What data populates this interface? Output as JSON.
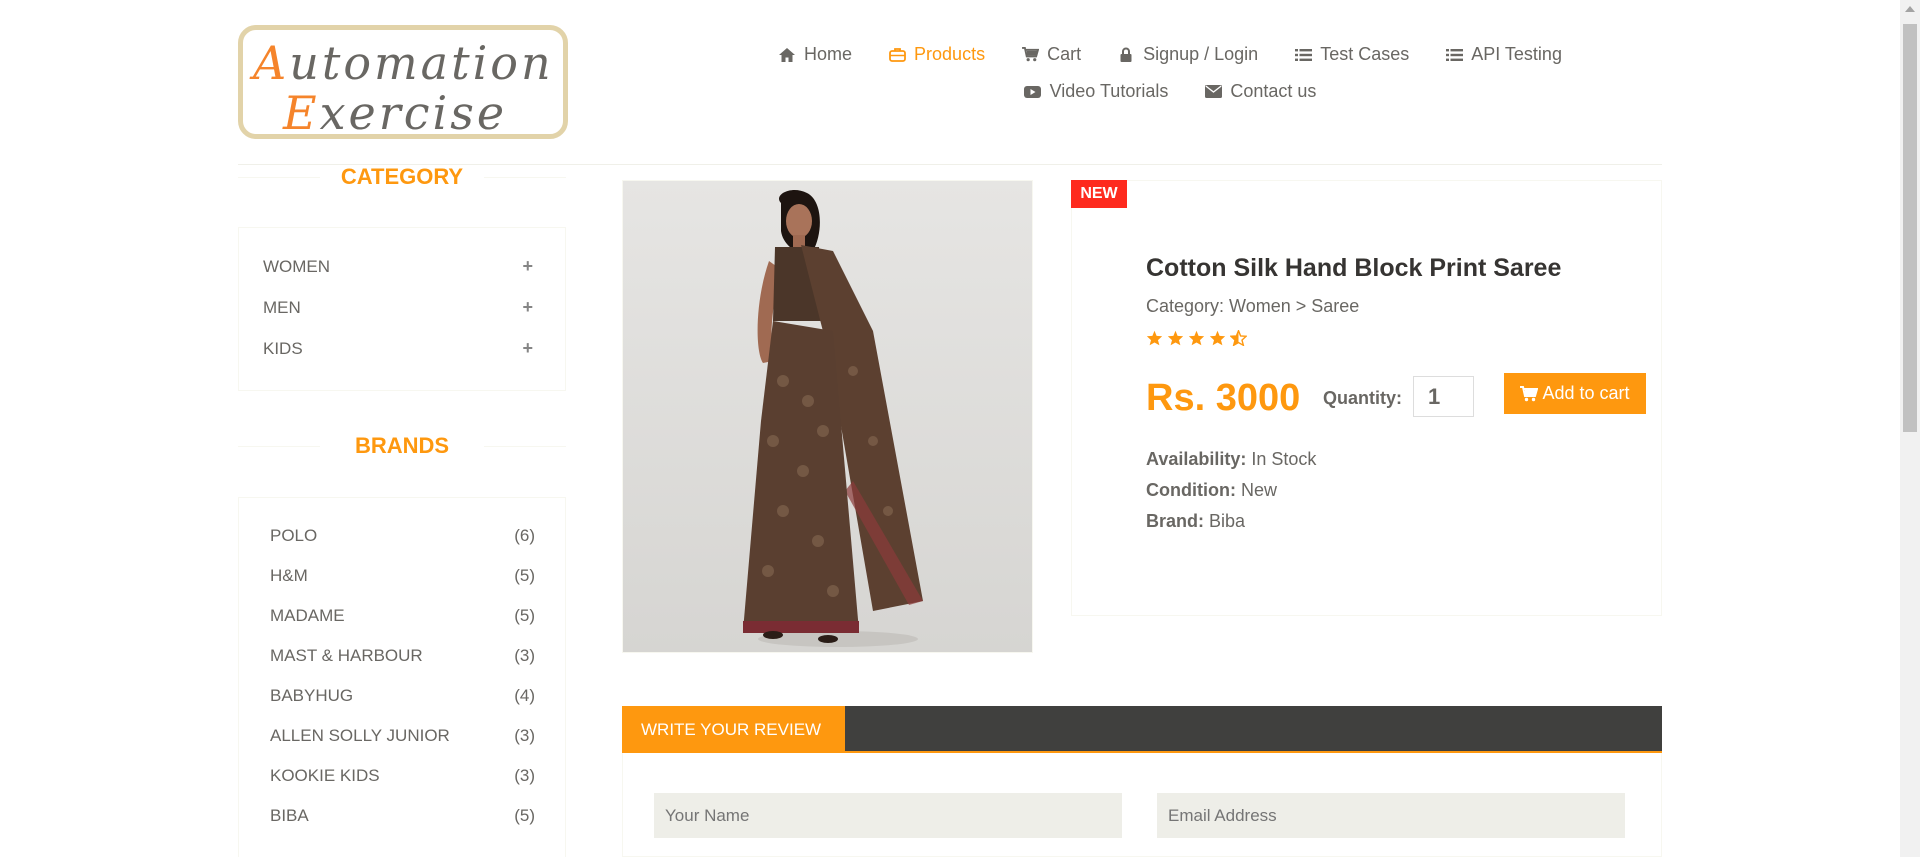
{
  "logo": {
    "line1_cap": "A",
    "line1_rest": "utomation",
    "line2_cap": "E",
    "line2_rest": "xercise"
  },
  "nav": {
    "row1": [
      {
        "label": "Home",
        "icon": "home-icon"
      },
      {
        "label": "Products",
        "icon": "briefcase-icon",
        "active": true
      },
      {
        "label": "Cart",
        "icon": "cart-icon"
      },
      {
        "label": "Signup / Login",
        "icon": "lock-icon"
      },
      {
        "label": "Test Cases",
        "icon": "list-icon"
      },
      {
        "label": "API Testing",
        "icon": "list-icon"
      }
    ],
    "row2": [
      {
        "label": "Video Tutorials",
        "icon": "youtube-icon"
      },
      {
        "label": "Contact us",
        "icon": "envelope-icon"
      }
    ]
  },
  "sidebar": {
    "category_title": "CATEGORY",
    "categories": [
      "WOMEN",
      "MEN",
      "KIDS"
    ],
    "brands_title": "BRANDS",
    "brands": [
      {
        "name": "POLO",
        "count": "(6)"
      },
      {
        "name": "H&M",
        "count": "(5)"
      },
      {
        "name": "MADAME",
        "count": "(5)"
      },
      {
        "name": "MAST & HARBOUR",
        "count": "(3)"
      },
      {
        "name": "BABYHUG",
        "count": "(4)"
      },
      {
        "name": "ALLEN SOLLY JUNIOR",
        "count": "(3)"
      },
      {
        "name": "KOOKIE KIDS",
        "count": "(3)"
      },
      {
        "name": "BIBA",
        "count": "(5)"
      }
    ]
  },
  "product": {
    "badge": "NEW",
    "name": "Cotton Silk Hand Block Print Saree",
    "category": "Category: Women > Saree",
    "rating": 4.5,
    "price": "Rs. 3000",
    "quantity_label": "Quantity:",
    "quantity": "1",
    "add_to_cart": "Add to cart",
    "availability_label": "Availability:",
    "availability": "In Stock",
    "condition_label": "Condition:",
    "condition": "New",
    "brand_label": "Brand:",
    "brand": "Biba"
  },
  "review": {
    "tab_label": "WRITE YOUR REVIEW",
    "name_placeholder": "Your Name",
    "email_placeholder": "Email Address"
  },
  "colors": {
    "accent": "#fe980f",
    "badge": "#fe2a1e",
    "review_bar": "#40403e"
  }
}
